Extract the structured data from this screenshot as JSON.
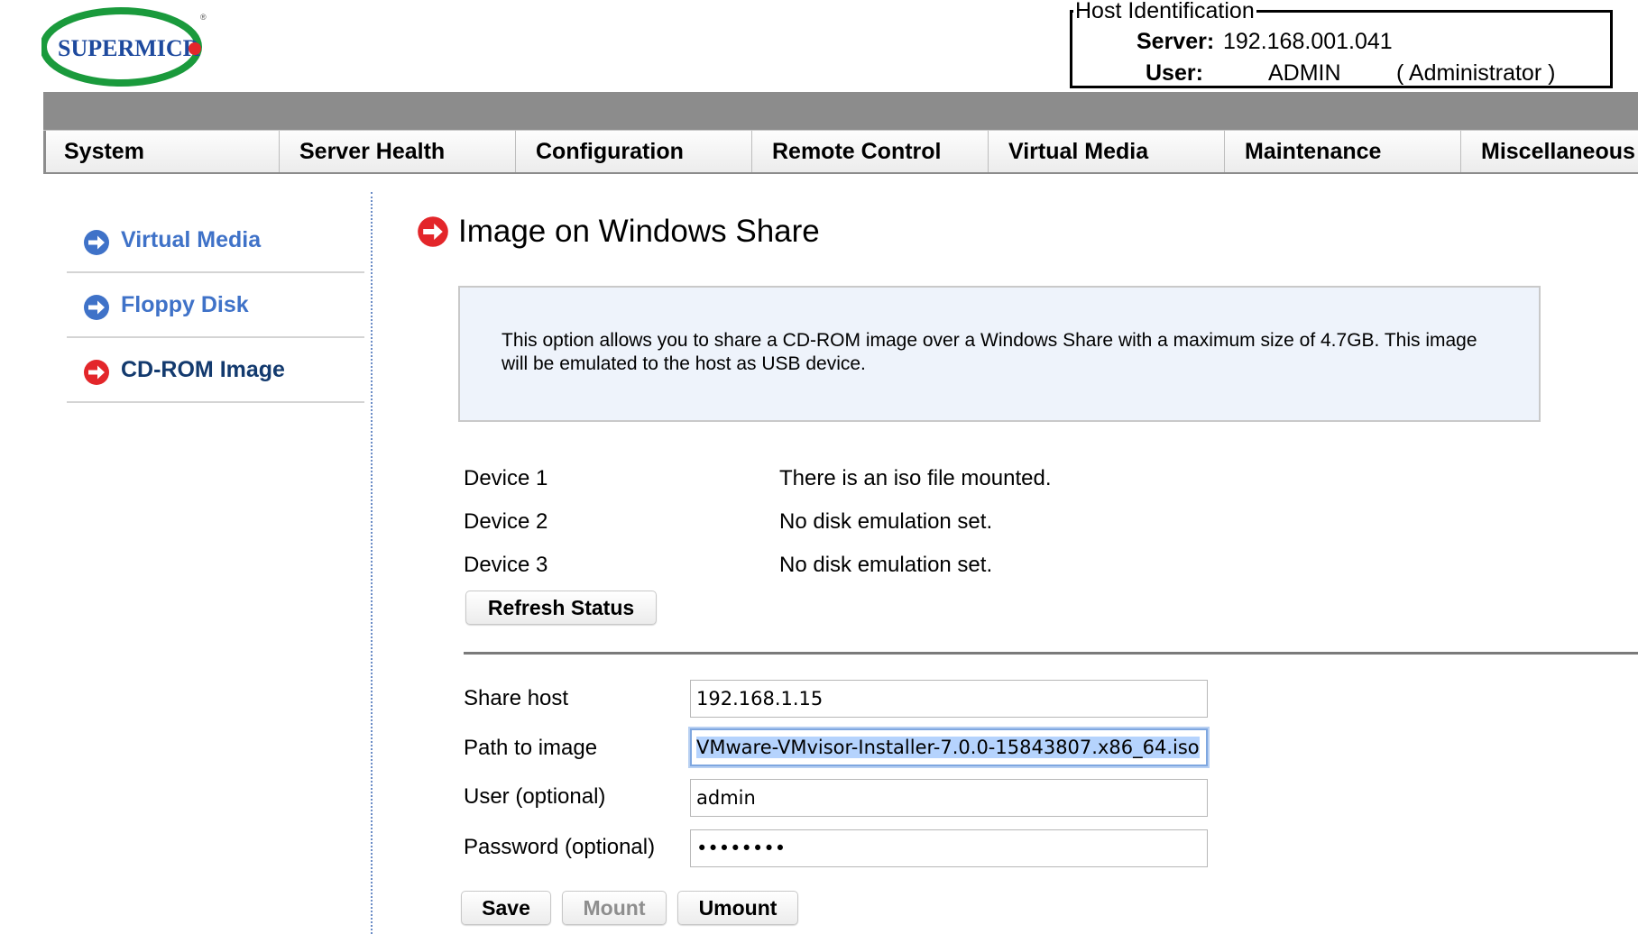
{
  "logo": {
    "text": "SUPERMICR",
    "registered": "®"
  },
  "host_identification": {
    "legend": "Host Identification",
    "server_label": "Server:",
    "server_value": "192.168.001.041",
    "user_label": "User:",
    "user_value": "ADMIN",
    "user_role": "( Administrator )"
  },
  "nav": {
    "items": [
      {
        "label": "System"
      },
      {
        "label": "Server Health"
      },
      {
        "label": "Configuration"
      },
      {
        "label": "Remote Control"
      },
      {
        "label": "Virtual Media"
      },
      {
        "label": "Maintenance"
      },
      {
        "label": "Miscellaneous"
      }
    ]
  },
  "sidebar": {
    "items": [
      {
        "label": "Virtual Media",
        "icon": "arrow-right-circle-blue-icon",
        "active": false
      },
      {
        "label": "Floppy Disk",
        "icon": "arrow-right-circle-blue-icon",
        "active": false
      },
      {
        "label": "CD-ROM Image",
        "icon": "arrow-right-circle-red-icon",
        "active": true
      }
    ]
  },
  "main": {
    "title": "Image on Windows Share",
    "info": "This option allows you to share a CD-ROM image over a Windows Share with a maximum size of 4.7GB. This image will be emulated to the host as USB device.",
    "devices": [
      {
        "label": "Device 1",
        "status": "There is an iso file mounted."
      },
      {
        "label": "Device 2",
        "status": "No disk emulation set."
      },
      {
        "label": "Device 3",
        "status": "No disk emulation set."
      }
    ],
    "refresh_button": "Refresh Status",
    "form": {
      "share_host": {
        "label": "Share host",
        "value": "192.168.1.15"
      },
      "path_to_image": {
        "label": "Path to image",
        "value": "VMware-VMvisor-Installer-7.0.0-15843807.x86_64.iso"
      },
      "user": {
        "label": "User (optional)",
        "value": "admin"
      },
      "password": {
        "label": "Password (optional)",
        "value": "••••••••"
      }
    },
    "buttons": {
      "save": "Save",
      "mount": "Mount",
      "umount": "Umount"
    }
  },
  "colors": {
    "nav_band": "#8c8c8c",
    "sidebar_link_blue": "#3f72c8",
    "sidebar_link_active": "#133a6e",
    "arrow_blue": "#3f72c8",
    "arrow_red": "#e3262a",
    "info_bg": "#eef3fb",
    "logo_green": "#1a9a3c",
    "logo_blue": "#1e4a9e"
  }
}
